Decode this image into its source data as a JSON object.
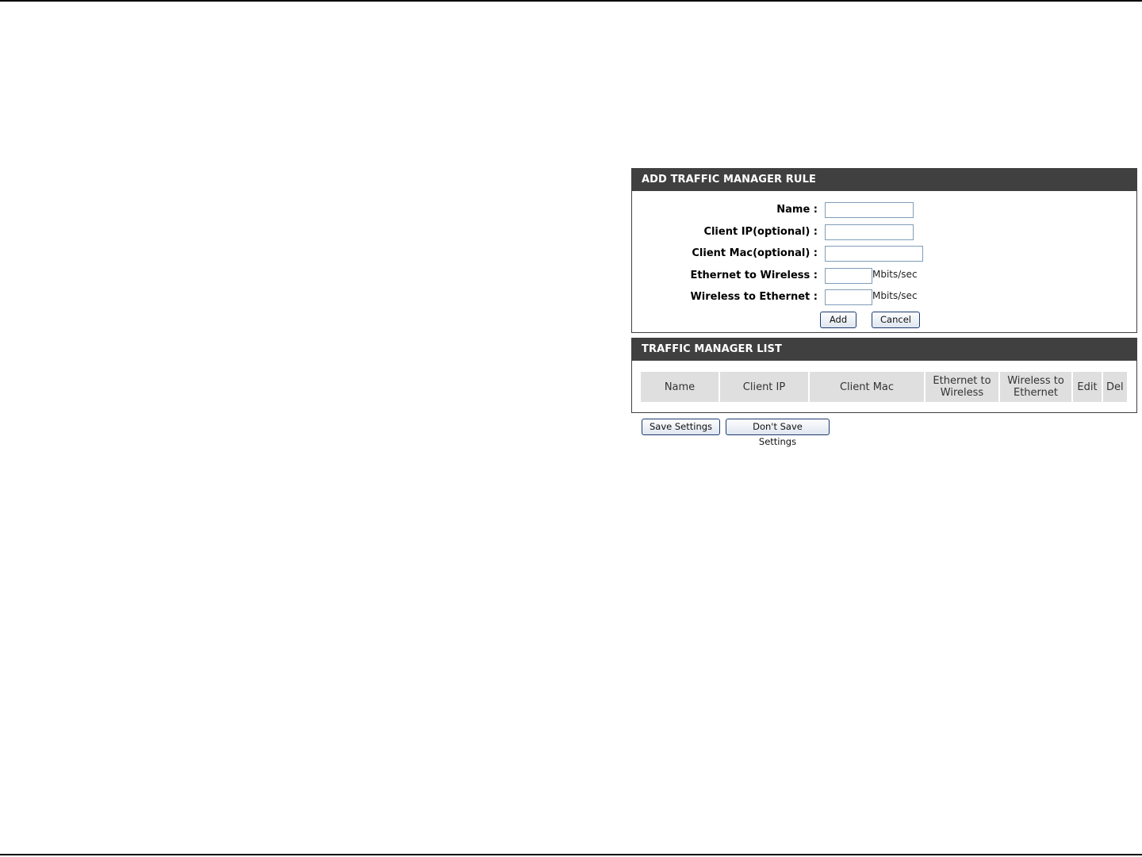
{
  "add_rule": {
    "title": "ADD TRAFFIC MANAGER RULE",
    "fields": [
      {
        "label": "Name :",
        "value": "",
        "unit": ""
      },
      {
        "label": "Client IP(optional) :",
        "value": "",
        "unit": ""
      },
      {
        "label": "Client Mac(optional) :",
        "value": "",
        "unit": ""
      },
      {
        "label": "Ethernet to Wireless :",
        "value": "",
        "unit": "Mbits/sec"
      },
      {
        "label": "Wireless to Ethernet :",
        "value": "",
        "unit": "Mbits/sec"
      }
    ],
    "add_label": "Add",
    "cancel_label": "Cancel"
  },
  "list": {
    "title": "TRAFFIC MANAGER LIST",
    "columns": [
      "Name",
      "Client IP",
      "Client Mac",
      "Ethernet to Wireless",
      "Wireless to Ethernet",
      "Edit",
      "Del"
    ],
    "rows": []
  },
  "actions": {
    "save_label": "Save Settings",
    "dont_save_label": "Don't Save Settings"
  }
}
